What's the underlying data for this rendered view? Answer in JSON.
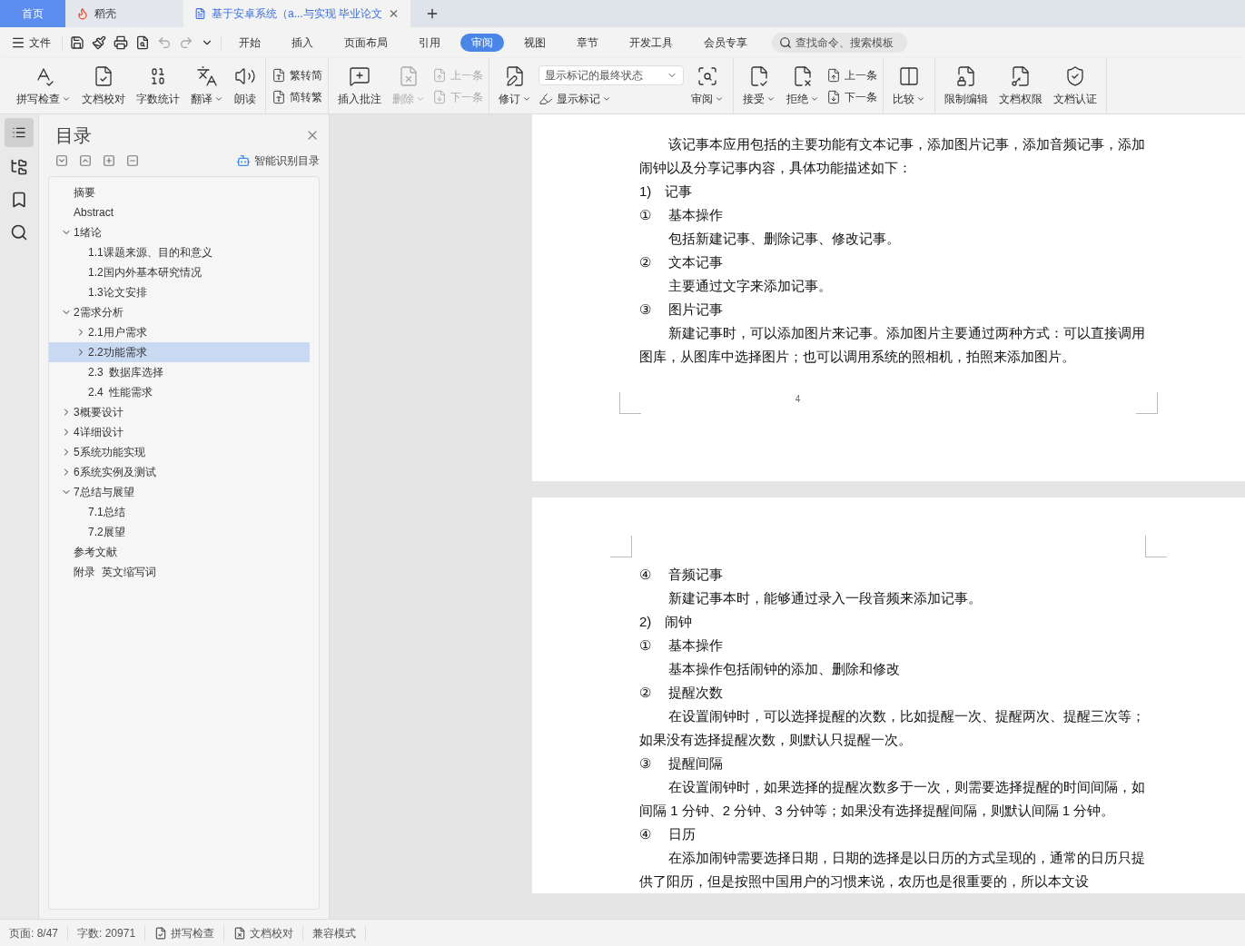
{
  "tabs": [
    {
      "label": "首页",
      "kind": "home",
      "selected": false
    },
    {
      "label": "稻壳",
      "kind": "docer",
      "selected": false
    },
    {
      "label": "基于安卓系统（a...与实现 毕业论文",
      "kind": "doc",
      "selected": true
    }
  ],
  "file_menu": "文件",
  "menu_tabs": [
    {
      "label": "开始",
      "selected": false
    },
    {
      "label": "插入",
      "selected": false
    },
    {
      "label": "页面布局",
      "selected": false
    },
    {
      "label": "引用",
      "selected": false
    },
    {
      "label": "审阅",
      "selected": true
    },
    {
      "label": "视图",
      "selected": false
    },
    {
      "label": "章节",
      "selected": false
    },
    {
      "label": "开发工具",
      "selected": false
    },
    {
      "label": "会员专享",
      "selected": false
    }
  ],
  "search": {
    "placeholder": "查找命令、搜索模板"
  },
  "ribbon": [
    {
      "columns": [
        {
          "kind": "large",
          "label": "拼写检查",
          "caret": true,
          "disabled": false
        },
        {
          "kind": "large",
          "label": "文档校对",
          "caret": false,
          "disabled": false
        },
        {
          "kind": "large",
          "label": "字数统计",
          "caret": false,
          "disabled": false
        },
        {
          "kind": "large",
          "label": "翻译",
          "caret": true,
          "disabled": false
        },
        {
          "kind": "large",
          "label": "朗读",
          "caret": false,
          "disabled": false
        }
      ]
    },
    {
      "columns": [
        {
          "kind": "stack",
          "items": [
            {
              "kind": "small",
              "label": "繁转简",
              "caret": false,
              "disabled": false
            },
            {
              "kind": "small",
              "label": "简转繁",
              "caret": false,
              "disabled": false
            }
          ]
        }
      ]
    },
    {
      "columns": [
        {
          "kind": "large",
          "label": "插入批注",
          "caret": false,
          "disabled": false
        },
        {
          "kind": "large",
          "label": "删除",
          "caret": true,
          "disabled": true
        },
        {
          "kind": "stack",
          "items": [
            {
              "kind": "small",
              "label": "上一条",
              "caret": false,
              "disabled": true
            },
            {
              "kind": "small",
              "label": "下一条",
              "caret": false,
              "disabled": true
            }
          ]
        }
      ]
    },
    {
      "columns": [
        {
          "kind": "large",
          "label": "修订",
          "caret": true,
          "disabled": false
        },
        {
          "kind": "stack",
          "items": [
            {
              "kind": "select",
              "label": "显示标记的最终状态"
            },
            {
              "kind": "small",
              "label": "显示标记",
              "caret": true,
              "disabled": false
            }
          ]
        },
        {
          "kind": "large",
          "label": "审阅",
          "caret": true,
          "disabled": false
        }
      ]
    },
    {
      "columns": [
        {
          "kind": "large",
          "label": "接受",
          "caret": true,
          "disabled": false
        },
        {
          "kind": "large",
          "label": "拒绝",
          "caret": true,
          "disabled": false
        },
        {
          "kind": "stack",
          "items": [
            {
              "kind": "small",
              "label": "上一条",
              "caret": false,
              "disabled": false
            },
            {
              "kind": "small",
              "label": "下一条",
              "caret": false,
              "disabled": false
            }
          ]
        }
      ]
    },
    {
      "columns": [
        {
          "kind": "large",
          "label": "比较",
          "caret": true,
          "disabled": false
        }
      ]
    },
    {
      "columns": [
        {
          "kind": "large",
          "label": "限制编辑",
          "caret": false,
          "disabled": false
        },
        {
          "kind": "large",
          "label": "文档权限",
          "caret": false,
          "disabled": false
        },
        {
          "kind": "large",
          "label": "文档认证",
          "caret": false,
          "disabled": false
        }
      ]
    }
  ],
  "nav": {
    "title": "目录",
    "smart_button": "智能识别目录",
    "tree": [
      {
        "label": "摘要",
        "selected": false
      },
      {
        "label": "Abstract",
        "selected": false
      },
      {
        "label": "1绪论",
        "selected": false,
        "expanded": true,
        "children": [
          {
            "label": "1.1课题来源、目的和意义",
            "selected": false
          },
          {
            "label": "1.2国内外基本研究情况",
            "selected": false
          },
          {
            "label": "1.3论文安排",
            "selected": false
          }
        ]
      },
      {
        "label": "2需求分析",
        "selected": false,
        "expanded": true,
        "children": [
          {
            "label": "2.1用户需求",
            "selected": false,
            "expanded": false
          },
          {
            "label": "2.2功能需求",
            "selected": true,
            "expanded": false
          },
          {
            "label": "2.3  数据库选择",
            "selected": false
          },
          {
            "label": "2.4  性能需求",
            "selected": false
          }
        ]
      },
      {
        "label": "3概要设计",
        "selected": false,
        "expanded": false
      },
      {
        "label": "4详细设计",
        "selected": false,
        "expanded": false
      },
      {
        "label": "5系统功能实现",
        "selected": false,
        "expanded": false
      },
      {
        "label": "6系统实例及测试",
        "selected": false,
        "expanded": false
      },
      {
        "label": "7总结与展望",
        "selected": false,
        "expanded": true,
        "children": [
          {
            "label": "7.1总结",
            "selected": false
          },
          {
            "label": "7.2展望",
            "selected": false
          }
        ]
      },
      {
        "label": "参考文献",
        "selected": false
      },
      {
        "label": "附录  英文缩写词",
        "selected": false
      }
    ]
  },
  "pages": [
    {
      "page_number": "4",
      "paragraphs": [
        {
          "kind": "body",
          "text": "该记事本应用包括的主要功能有文本记事，添加图片记事，添加音频记事，添加闹钟以及分享记事内容，具体功能描述如下："
        },
        {
          "kind": "heading",
          "marker": "1)",
          "text": "记事"
        },
        {
          "kind": "circled",
          "marker": "①",
          "text": "基本操作"
        },
        {
          "kind": "indented",
          "text": "包括新建记事、删除记事、修改记事。"
        },
        {
          "kind": "circled",
          "marker": "②",
          "text": "文本记事"
        },
        {
          "kind": "indented",
          "text": "主要通过文字来添加记事。"
        },
        {
          "kind": "circled",
          "marker": "③",
          "text": "图片记事"
        },
        {
          "kind": "body",
          "text": "新建记事时，可以添加图片来记事。添加图片主要通过两种方式：可以直接调用图库，从图库中选择图片；也可以调用系统的照相机，拍照来添加图片。"
        }
      ]
    },
    {
      "paragraphs": [
        {
          "kind": "circled",
          "marker": "④",
          "text": "音频记事"
        },
        {
          "kind": "indented",
          "text": "新建记事本时，能够通过录入一段音频来添加记事。"
        },
        {
          "kind": "heading",
          "marker": "2)",
          "text": "闹钟"
        },
        {
          "kind": "circled",
          "marker": "①",
          "text": "基本操作"
        },
        {
          "kind": "indented",
          "text": "基本操作包括闹钟的添加、删除和修改"
        },
        {
          "kind": "circled",
          "marker": "②",
          "text": "提醒次数"
        },
        {
          "kind": "body",
          "text": "在设置闹钟时，可以选择提醒的次数，比如提醒一次、提醒两次、提醒三次等；如果没有选择提醒次数，则默认只提醒一次。"
        },
        {
          "kind": "circled",
          "marker": "③",
          "text": "提醒间隔"
        },
        {
          "kind": "body",
          "text": "在设置闹钟时，如果选择的提醒次数多于一次，则需要选择提醒的时间间隔，如间隔 1 分钟、2 分钟、3 分钟等；如果没有选择提醒间隔，则默认间隔 1 分钟。"
        },
        {
          "kind": "circled",
          "marker": "④",
          "text": "日历"
        },
        {
          "kind": "body",
          "text": "在添加闹钟需要选择日期，日期的选择是以日历的方式呈现的，通常的日历只提供了阳历，但是按照中国用户的习惯来说，农历也是很重要的，所以本文设"
        }
      ]
    }
  ],
  "status_bar": {
    "page": "页面: 8/47",
    "words": "字数: 20971",
    "buttons": [
      {
        "label": "拼写检查"
      },
      {
        "label": "文档校对"
      }
    ],
    "mode": "兼容模式"
  }
}
